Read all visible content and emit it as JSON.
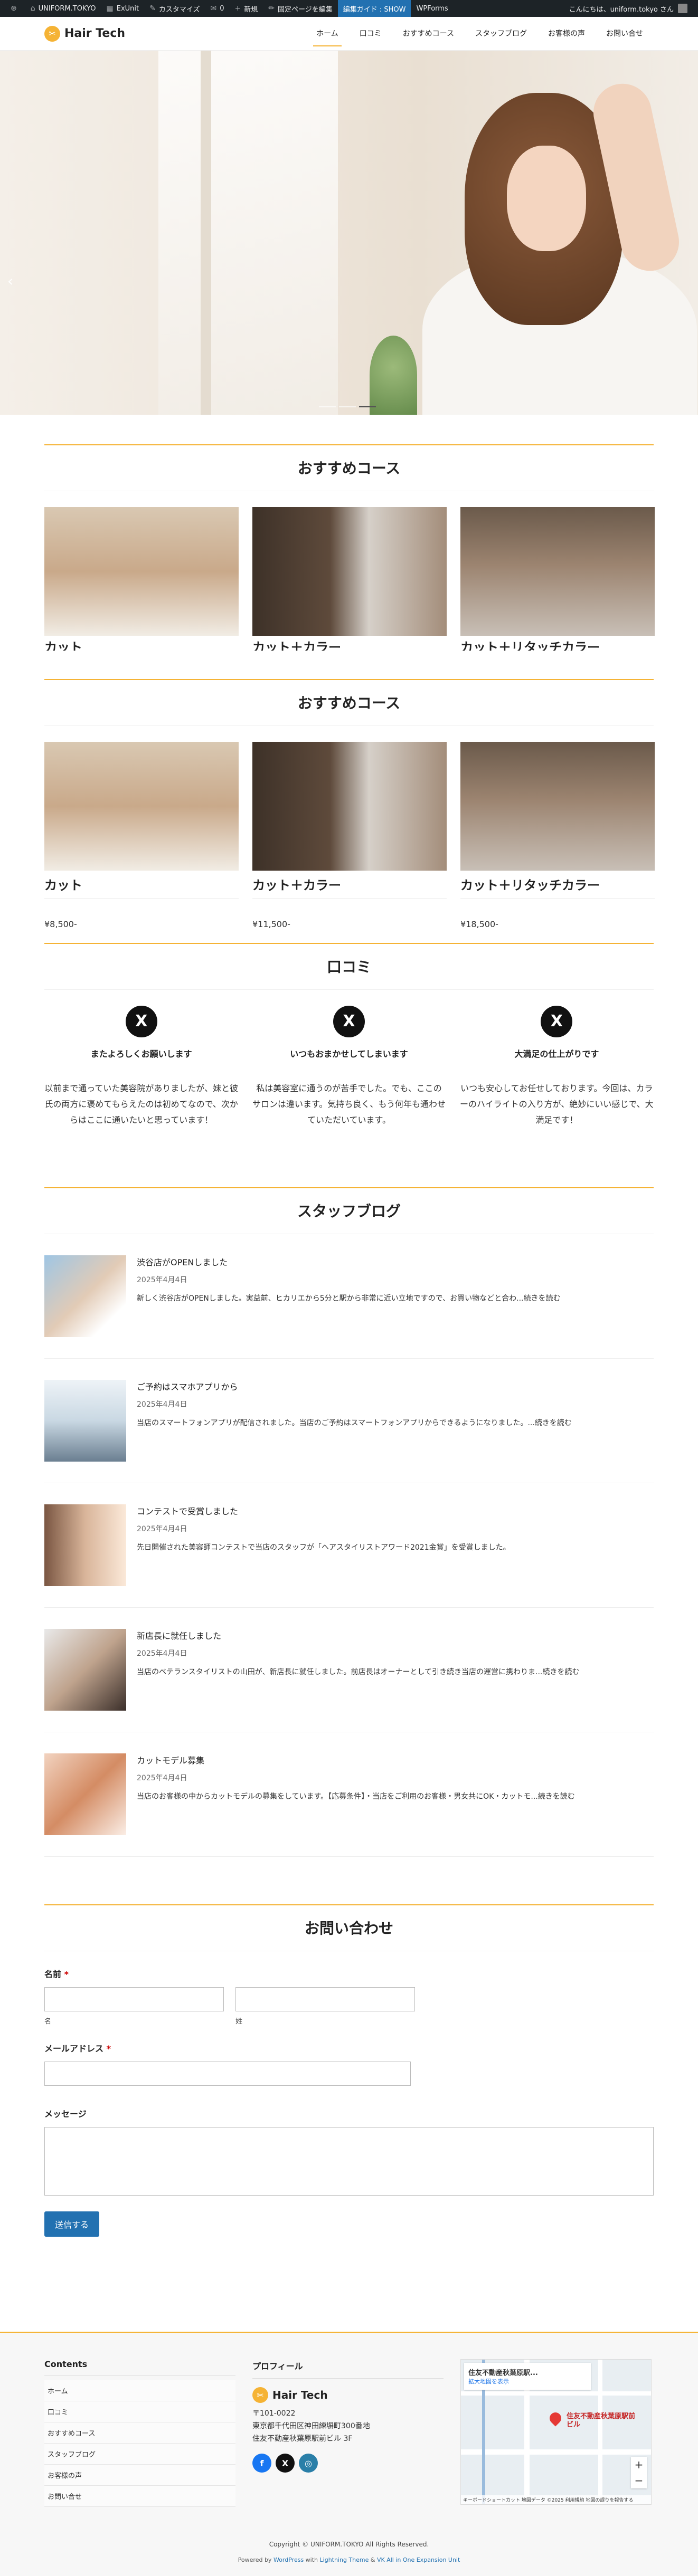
{
  "adminbar": {
    "items": [
      "UNIFORM.TOKYO",
      "ExUnit",
      "カスタマイズ",
      "0",
      "新規",
      "固定ページを編集",
      "編集ガイド : SHOW",
      "WPForms"
    ],
    "greeting": "こんにちは、uniform.tokyo さん"
  },
  "header": {
    "logo": "Hair Tech",
    "nav": [
      "ホーム",
      "口コミ",
      "おすすめコース",
      "スタッフブログ",
      "お客様の声",
      "お問い合せ"
    ]
  },
  "courses_overlay": {
    "title": "おすすめコース",
    "items": [
      "カット",
      "カット＋カラー",
      "カット＋リタッチカラー"
    ]
  },
  "courses": {
    "title": "おすすめコース",
    "items": [
      {
        "name": "カット",
        "price": "¥8,500-"
      },
      {
        "name": "カット＋カラー",
        "price": "¥11,500-"
      },
      {
        "name": "カット＋リタッチカラー",
        "price": "¥18,500-"
      }
    ]
  },
  "reviews": {
    "title": "口コミ",
    "icon": "X",
    "items": [
      {
        "title": "またよろしくお願いします",
        "text": "以前まで通っていた美容院がありましたが、妹と彼氏の両方に褒めてもらえたのは初めてなので、次からはここに通いたいと思っています！"
      },
      {
        "title": "いつもおまかせしてしまいます",
        "text": "私は美容室に通うのが苦手でした。でも、ここのサロンは違います。気持ち良く、もう何年も通わせていただいています。"
      },
      {
        "title": "大満足の仕上がりです",
        "text": "いつも安心してお任せしております。今回は、カラーのハイライトの入り方が、絶妙にいい感じで、大満足です！"
      }
    ]
  },
  "blog": {
    "title": "スタッフブログ",
    "items": [
      {
        "title": "渋谷店がOPENしました",
        "date": "2025年4月4日",
        "excerpt": "新しく渋谷店がOPENしました。実益前、ヒカリエから5分と駅から非常に近い立地ですので、お買い物などと合わ...続きを読む"
      },
      {
        "title": "ご予約はスマホアプリから",
        "date": "2025年4月4日",
        "excerpt": "当店のスマートフォンアプリが配信されました。当店のご予約はスマートフォンアプリからできるようになりました。...続きを読む"
      },
      {
        "title": "コンテストで受賞しました",
        "date": "2025年4月4日",
        "excerpt": "先日開催された美容師コンテストで当店のスタッフが「ヘアスタイリストアワード2021金賞」を受賞しました。"
      },
      {
        "title": "新店長に就任しました",
        "date": "2025年4月4日",
        "excerpt": "当店のベテランスタイリストの山田が、新店長に就任しました。前店長はオーナーとして引き続き当店の運営に携わりま...続きを読む"
      },
      {
        "title": "カットモデル募集",
        "date": "2025年4月4日",
        "excerpt": "当店のお客様の中からカットモデルの募集をしています。【応募条件】・当店をご利用のお客様・男女共にOK・カットモ...続きを読む"
      }
    ]
  },
  "contact": {
    "title": "お問い合わせ",
    "name_label": "名前",
    "required_mark": "*",
    "first_label": "名",
    "last_label": "姓",
    "email_label": "メールアドレス",
    "message_label": "メッセージ",
    "submit": "送信する"
  },
  "footer": {
    "contents_title": "Contents",
    "contents": [
      "ホーム",
      "口コミ",
      "おすすめコース",
      "スタッフブログ",
      "お客様の声",
      "お問い合せ"
    ],
    "profile_title": "プロフィール",
    "logo": "Hair Tech",
    "address": [
      "〒101-0022",
      "東京都千代田区神田練塀町300番地",
      "住友不動産秋葉原駅前ビル 3F"
    ],
    "social": [
      "f",
      "X",
      "◎"
    ],
    "map": {
      "place": "住友不動産秋葉原駅...",
      "link": "拡大地図を表示",
      "pin_label": "住友不動産秋葉原駅前ビル",
      "zoom_in": "+",
      "zoom_out": "−",
      "note": "キーボードショートカット 地図データ ©2025 利用規約 地図の誤りを報告する"
    },
    "copyright": "Copyright © UNIFORM.TOKYO All Rights Reserved.",
    "powered_prefix": "Powered by ",
    "powered_wp": "WordPress",
    "powered_mid": " with ",
    "powered_theme": "Lightning Theme",
    "powered_amp": " & ",
    "powered_vk": "VK All in One Expansion Unit"
  },
  "colors": {
    "accent": "#f5b335",
    "button": "#2271b1",
    "adminbar": "#1d2327"
  }
}
